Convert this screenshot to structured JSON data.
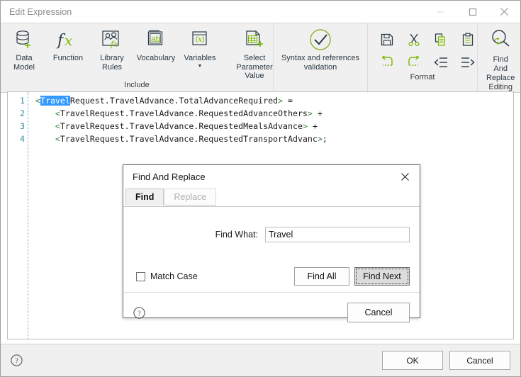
{
  "window": {
    "title": "Edit Expression",
    "controls": [
      {
        "name": "minimize",
        "glyph": "minimize-icon"
      },
      {
        "name": "maximize",
        "glyph": "maximize-icon"
      },
      {
        "name": "close",
        "glyph": "close-icon"
      }
    ]
  },
  "ribbon": {
    "groups": [
      {
        "label": "Include",
        "buttons": [
          {
            "caption": "Data\nModel",
            "icon": "database-add-icon",
            "dropdown": false
          },
          {
            "caption": "Function",
            "icon": "fx-icon",
            "dropdown": false
          },
          {
            "caption": "Library\nRules",
            "icon": "library-rules-icon",
            "dropdown": false
          },
          {
            "caption": "Vocabulary",
            "icon": "vocabulary-ab-icon",
            "dropdown": false
          },
          {
            "caption": "Variables",
            "icon": "variables-x-icon",
            "dropdown": true
          },
          {
            "caption": "Select Parameter\nValue",
            "icon": "select-parameter-value-icon",
            "dropdown": false
          }
        ]
      },
      {
        "label": "",
        "buttons": [
          {
            "caption": "Syntax and references\nvalidation",
            "icon": "check-circle-icon",
            "dropdown": false
          }
        ]
      },
      {
        "label": "Format",
        "icons": [
          {
            "name": "save-icon"
          },
          {
            "name": "cut-scissors-icon"
          },
          {
            "name": "copy-icon"
          },
          {
            "name": "paste-icon"
          },
          {
            "name": "undo-icon"
          },
          {
            "name": "redo-icon"
          },
          {
            "name": "decrease-indent-icon"
          },
          {
            "name": "increase-indent-icon"
          }
        ]
      },
      {
        "label": "Editing",
        "buttons": [
          {
            "caption": "Find And\nReplace",
            "icon": "find-replace-icon",
            "dropdown": false
          }
        ]
      }
    ]
  },
  "editor": {
    "line_numbers": [
      "1",
      "2",
      "3",
      "4"
    ],
    "lines": [
      {
        "indent": 0,
        "segments": [
          {
            "text": "<",
            "type": "angle"
          },
          {
            "text": "Travel",
            "type": "selected"
          },
          {
            "text": "Request.TravelAdvance.TotalAdvanceRequired",
            "type": "plain"
          },
          {
            "text": ">",
            "type": "angle"
          },
          {
            "text": " =",
            "type": "plain"
          }
        ]
      },
      {
        "indent": 1,
        "segments": [
          {
            "text": "<",
            "type": "angle"
          },
          {
            "text": "TravelRequest.TravelAdvance.RequestedAdvanceOthers",
            "type": "plain"
          },
          {
            "text": ">",
            "type": "angle"
          },
          {
            "text": " +",
            "type": "plain"
          }
        ]
      },
      {
        "indent": 1,
        "segments": [
          {
            "text": "<",
            "type": "angle"
          },
          {
            "text": "TravelRequest.TravelAdvance.RequestedMealsAdvance",
            "type": "plain"
          },
          {
            "text": ">",
            "type": "angle"
          },
          {
            "text": " +",
            "type": "plain"
          }
        ]
      },
      {
        "indent": 1,
        "segments": [
          {
            "text": "<",
            "type": "angle"
          },
          {
            "text": "TravelRequest.TravelAdvance.RequestedTransportAdvanc",
            "type": "plain"
          },
          {
            "text": ">",
            "type": "angle"
          },
          {
            "text": ";",
            "type": "plain"
          }
        ]
      }
    ]
  },
  "footer": {
    "help_icon": "help-circle-icon",
    "ok_label": "OK",
    "cancel_label": "Cancel"
  },
  "dialog": {
    "title": "Find And Replace",
    "close_icon": "close-icon",
    "tabs": [
      {
        "label": "Find",
        "active": true
      },
      {
        "label": "Replace",
        "active": false
      }
    ],
    "find_what_label": "Find What:",
    "find_what_value": "Travel",
    "find_what_placeholder": "",
    "match_case_label": "Match Case",
    "match_case_checked": false,
    "find_all_label": "Find All",
    "find_next_label": "Find Next",
    "cancel_label": "Cancel",
    "help_icon": "help-circle-icon"
  },
  "colors": {
    "accent_green": "#7ab800",
    "icon_dark": "#2b3a45",
    "selection_blue": "#3399ff",
    "gutter_teal": "#2e8b9b",
    "angle_green": "#3f7f3f",
    "ribbon_bg": "#f0f0f0"
  }
}
